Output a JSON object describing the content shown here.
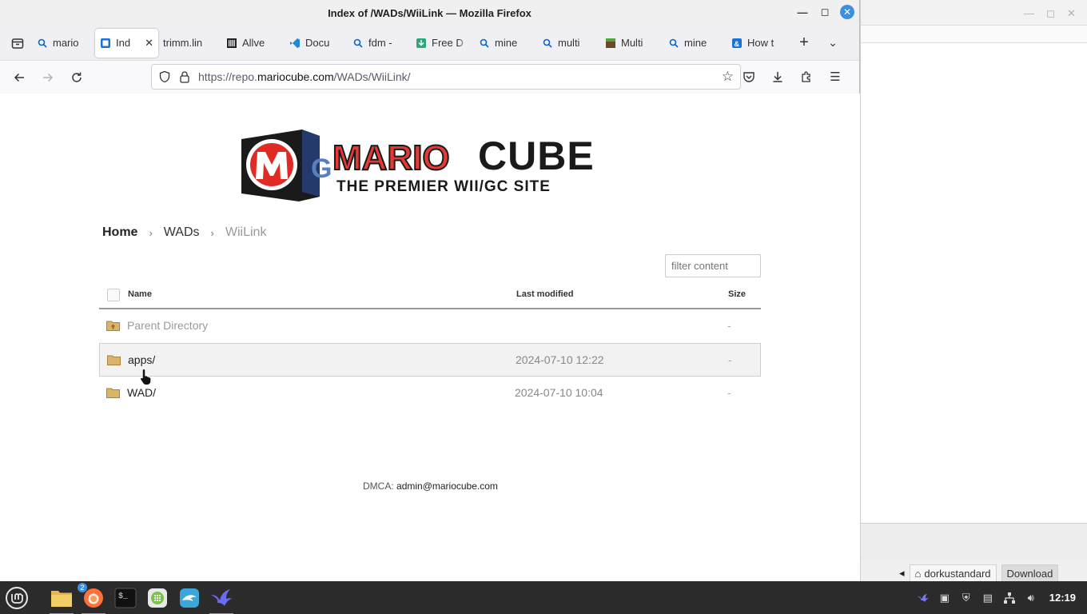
{
  "window": {
    "title": "Index of /WADs/WiiLink — Mozilla Firefox"
  },
  "tabs": [
    {
      "label": "mario",
      "icon": "search-icon",
      "active": false
    },
    {
      "label": "Ind",
      "icon": "page-icon",
      "active": true
    },
    {
      "label": "trimm.lin",
      "icon": "",
      "active": false
    },
    {
      "label": "Allve",
      "icon": "barcode-icon",
      "active": false
    },
    {
      "label": "Docu",
      "icon": "vscode-icon",
      "active": false
    },
    {
      "label": "fdm -",
      "icon": "search-icon",
      "active": false
    },
    {
      "label": "Free D",
      "icon": "download-app-icon",
      "active": false
    },
    {
      "label": "mine",
      "icon": "search-icon",
      "active": false
    },
    {
      "label": "multi",
      "icon": "search-icon",
      "active": false
    },
    {
      "label": "Multi",
      "icon": "minecraft-icon",
      "active": false
    },
    {
      "label": "mine",
      "icon": "search-icon",
      "active": false
    },
    {
      "label": "How t",
      "icon": "letter-icon",
      "active": false
    }
  ],
  "url": {
    "prefix": "https://repo.",
    "host": "mariocube.com",
    "path": "/WADs/WiiLink/"
  },
  "logo": {
    "word1": "MARIO",
    "word2": "CUBE",
    "tagline": "THE PREMIER WII/GC SITE"
  },
  "breadcrumb": {
    "home": "Home",
    "wads": "WADs",
    "current": "WiiLink"
  },
  "filter": {
    "placeholder": "filter content"
  },
  "table": {
    "headers": {
      "name": "Name",
      "modified": "Last modified",
      "size": "Size"
    },
    "rows": [
      {
        "name": "Parent Directory",
        "modified": "",
        "size": "-"
      },
      {
        "name": "apps/",
        "modified": "2024-07-10 12:22",
        "size": "-"
      },
      {
        "name": "WAD/",
        "modified": "2024-07-10 10:04",
        "size": "-"
      }
    ]
  },
  "footer": {
    "dmca_label": "DMCA:",
    "dmca_email": "admin@mariocube.com"
  },
  "background_window": {
    "tab1": "dorkustandard",
    "tab2": "Download"
  },
  "taskbar": {
    "clock": "12:19",
    "firefox_badge": "2"
  },
  "colors": {
    "accent": "#3d8fe0",
    "taskbar": "#2b2b2b"
  }
}
